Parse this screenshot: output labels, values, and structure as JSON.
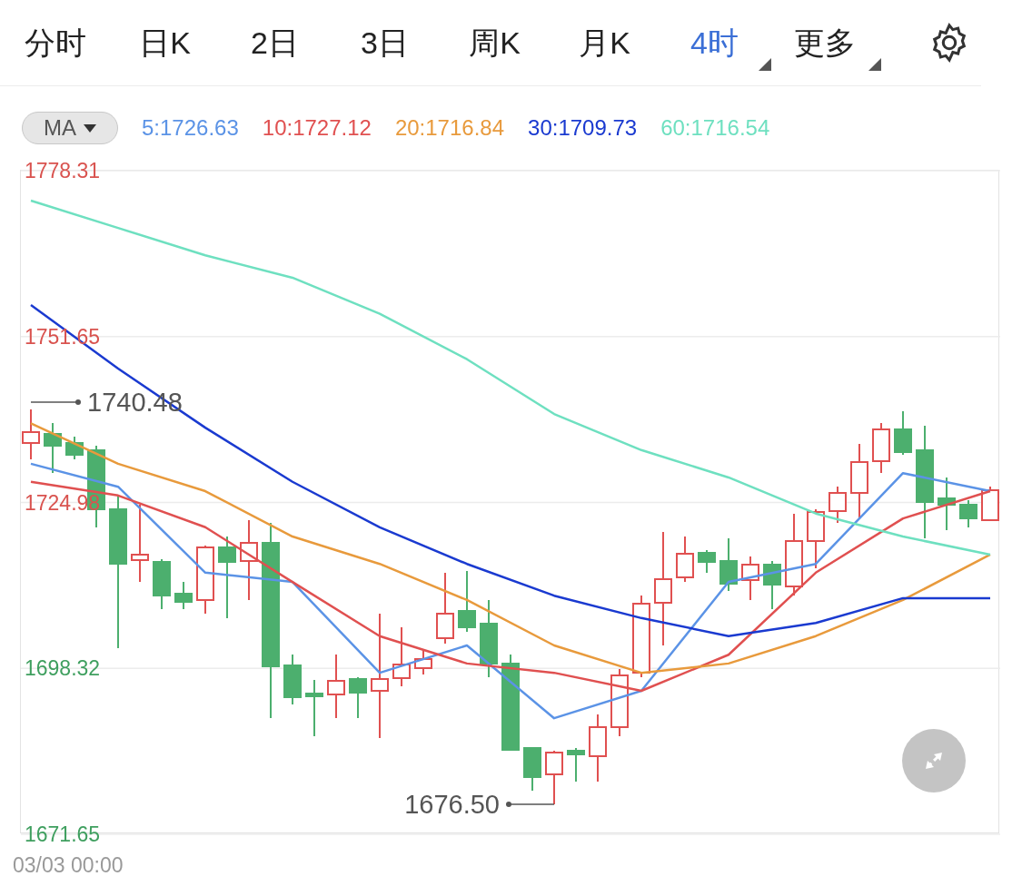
{
  "tabs": [
    {
      "label": "分时",
      "selected": false,
      "has_menu": false
    },
    {
      "label": "日K",
      "selected": false,
      "has_menu": false
    },
    {
      "label": "2日",
      "selected": false,
      "has_menu": false
    },
    {
      "label": "3日",
      "selected": false,
      "has_menu": false
    },
    {
      "label": "周K",
      "selected": false,
      "has_menu": false
    },
    {
      "label": "月K",
      "selected": false,
      "has_menu": false
    },
    {
      "label": "4时",
      "selected": true,
      "has_menu": true
    },
    {
      "label": "更多",
      "selected": false,
      "has_menu": true
    }
  ],
  "indicator_dropdown": {
    "value": "MA"
  },
  "chart": {
    "chart_data": {
      "type": "line",
      "grid": true,
      "ylim": [
        1671.65,
        1778.31
      ],
      "yticks": [
        {
          "value": 1778.31,
          "label": "1778.31"
        },
        {
          "value": 1751.65,
          "label": "1751.65"
        },
        {
          "value": 1724.98,
          "label": "1724.98"
        },
        {
          "value": 1698.32,
          "label": "1698.32"
        },
        {
          "value": 1671.65,
          "label": "1671.65"
        }
      ],
      "series": [
        {
          "name": "5:1726.63",
          "color": "#5b93e6",
          "values": [
            1731.2,
            1727.5,
            1713.7,
            1712.2,
            1697.6,
            1702,
            1690.3,
            1694.7,
            1712.2,
            1715.1,
            1729.7,
            1726.8
          ]
        },
        {
          "name": "10:1727.12",
          "color": "#e05050",
          "values": [
            1728.3,
            1726.1,
            1721,
            1712.2,
            1703.5,
            1699.1,
            1697.6,
            1694.7,
            1700.5,
            1713.7,
            1722.4,
            1726.8
          ]
        },
        {
          "name": "20:1716.84",
          "color": "#e89a3c",
          "values": [
            1737.7,
            1731.2,
            1726.8,
            1719.5,
            1715.1,
            1709.3,
            1702,
            1697.6,
            1699.1,
            1703.5,
            1709.3,
            1716.6
          ]
        },
        {
          "name": "30:1709.73",
          "color": "#1a3ad0",
          "values": [
            1756.7,
            1746.5,
            1737,
            1728.3,
            1721,
            1715.1,
            1710,
            1706.4,
            1703.5,
            1705.6,
            1709.6,
            1709.6
          ]
        },
        {
          "name": "60:1716.54",
          "color": "#6ee0c0",
          "values": [
            1773.5,
            1769.1,
            1764.7,
            1761.1,
            1755.3,
            1748,
            1739.2,
            1733.4,
            1729,
            1723.2,
            1719.5,
            1716.6
          ]
        }
      ],
      "annotations": [
        "1740.48",
        "1676.50"
      ]
    }
  },
  "time_label": "03/03 00:00"
}
